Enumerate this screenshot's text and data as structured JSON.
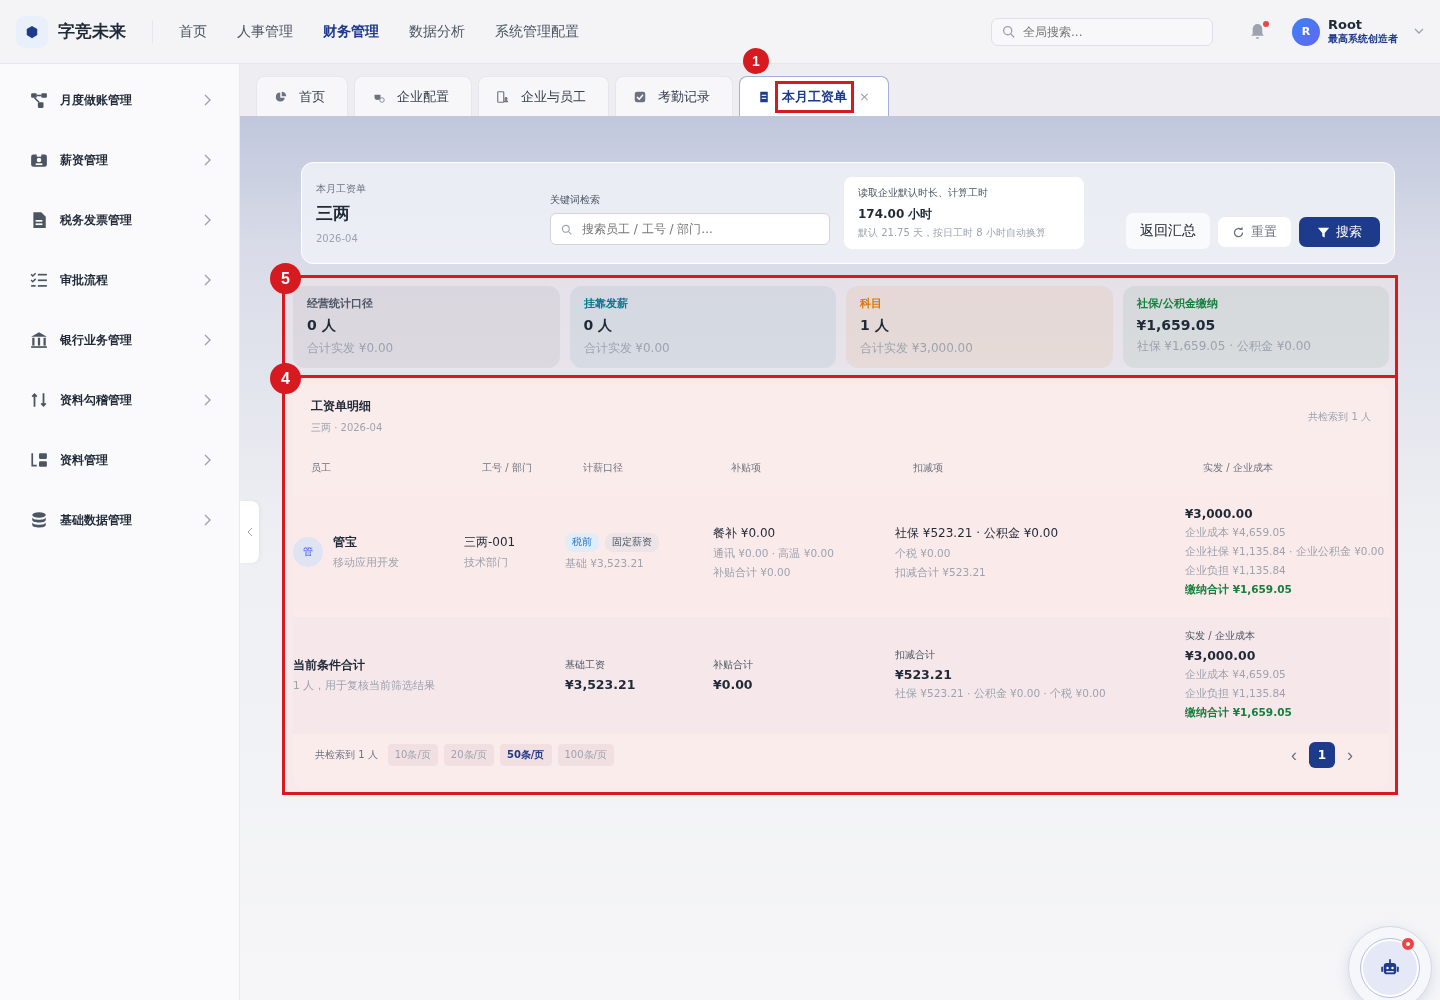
{
  "header": {
    "brand": "字竞未来",
    "nav": [
      {
        "label": "首页",
        "selected": false
      },
      {
        "label": "人事管理",
        "selected": false
      },
      {
        "label": "财务管理",
        "selected": true
      },
      {
        "label": "数据分析",
        "selected": false
      },
      {
        "label": "系统管理配置",
        "selected": false
      }
    ],
    "search": {
      "placeholder": "全局搜索..."
    },
    "notifications": {
      "unread": true
    },
    "user": {
      "avatar": "R",
      "name": "Root",
      "role": "最高系统创造者"
    }
  },
  "sidebar": {
    "items": [
      {
        "label": "月度做账管理"
      },
      {
        "label": "薪资管理"
      },
      {
        "label": "税务发票管理"
      },
      {
        "label": "审批流程"
      },
      {
        "label": "银行业务管理"
      },
      {
        "label": "资料勾稽管理"
      },
      {
        "label": "资料管理"
      },
      {
        "label": "基础数据管理"
      }
    ]
  },
  "tabs": [
    {
      "label": "首页",
      "selected": false
    },
    {
      "label": "企业配置",
      "selected": false
    },
    {
      "label": "企业与员工",
      "selected": false
    },
    {
      "label": "考勤记录",
      "selected": false
    },
    {
      "label": "本月工资单",
      "selected": true,
      "close": "×",
      "annotation": "1"
    }
  ],
  "filter": {
    "caption": "本月工资单",
    "title": "三两",
    "period": "2026-04",
    "keyword_label": "关键词检索",
    "placeholder": "搜索员工 / 工号 / 部门...",
    "hours": {
      "title": "读取企业默认时长、计算工时",
      "value": "174.00 小时",
      "note": "默认 21.75 天，按日工时 8 小时自动换算"
    },
    "buttons": [
      {
        "label": "返回汇总",
        "kind": "plain"
      },
      {
        "label": "重置",
        "kind": "reset"
      },
      {
        "label": "搜索",
        "kind": "primary"
      }
    ]
  },
  "stats": {
    "annotation": "5",
    "cards": [
      {
        "title": "经营统计口径",
        "value": "0 人",
        "note": "合计实发 ¥0.00",
        "color": "#4b5563"
      },
      {
        "title": "挂靠发薪",
        "value": "0 人",
        "note": "合计实发 ¥0.00",
        "color": "#0e7490"
      },
      {
        "title": "科目",
        "value": "1 人",
        "note": "合计实发 ¥3,000.00",
        "color": "#d97706"
      },
      {
        "title": "社保/公积金缴纳",
        "value": "¥1,659.05",
        "note": "社保 ¥1,659.05 · 公积金 ¥0.00",
        "color": "#15803d"
      }
    ]
  },
  "detail": {
    "annotation": "4",
    "title": "工资单明细",
    "subtitle": "三两 · 2026-04",
    "count": "共检索到 1 人",
    "columns": [
      "员工",
      "工号 / 部门",
      "计薪口径",
      "补贴项",
      "扣减项",
      "实发 / 企业成本"
    ],
    "rows": [
      {
        "avatar": "管",
        "name": "管宝",
        "team": "移动应用开发",
        "code": "三两-001",
        "dept": "技术部门",
        "tags": [
          {
            "label": "税前",
            "kind": "info"
          },
          {
            "label": "固定薪资",
            "kind": "neutral"
          }
        ],
        "base": "基础 ¥3,523.21",
        "allowance": {
          "main": "餐补 ¥0.00",
          "lines": [
            "通讯 ¥0.00 · 高温 ¥0.00",
            "补贴合计 ¥0.00"
          ]
        },
        "deduction": {
          "main": "社保 ¥523.21 · 公积金 ¥0.00",
          "lines": [
            "个税 ¥0.00",
            "扣减合计 ¥523.21"
          ]
        },
        "pay": {
          "main": "¥3,000.00",
          "lines": [
            "企业成本 ¥4,659.05",
            "企业社保 ¥1,135.84 · 企业公积金 ¥0.00",
            "企业负担 ¥1,135.84"
          ],
          "highlight": "缴纳合计 ¥1,659.05"
        }
      }
    ],
    "total": {
      "label": "当前条件合计",
      "note": "1 人，用于复核当前筛选结果",
      "base": {
        "label": "基础工资",
        "value": "¥3,523.21"
      },
      "allowance": {
        "label": "补贴合计",
        "value": "¥0.00"
      },
      "deduction": {
        "label": "扣减合计",
        "value": "¥523.21",
        "note": "社保 ¥523.21 · 公积金 ¥0.00 · 个税 ¥0.00"
      },
      "pay": {
        "label": "实发 / 企业成本",
        "value": "¥3,000.00",
        "lines": [
          "企业成本 ¥4,659.05",
          "企业负担 ¥1,135.84"
        ],
        "highlight": "缴纳合计 ¥1,659.05"
      }
    },
    "footer": {
      "count": "共检索到 1 人",
      "page_sizes": [
        {
          "label": "10条/页",
          "selected": false
        },
        {
          "label": "20条/页",
          "selected": false
        },
        {
          "label": "50条/页",
          "selected": true
        },
        {
          "label": "100条/页",
          "selected": false
        }
      ],
      "prev": "‹",
      "next": "›",
      "pages": [
        {
          "label": "1",
          "selected": true
        }
      ]
    }
  },
  "assistant": {
    "unread": true
  }
}
